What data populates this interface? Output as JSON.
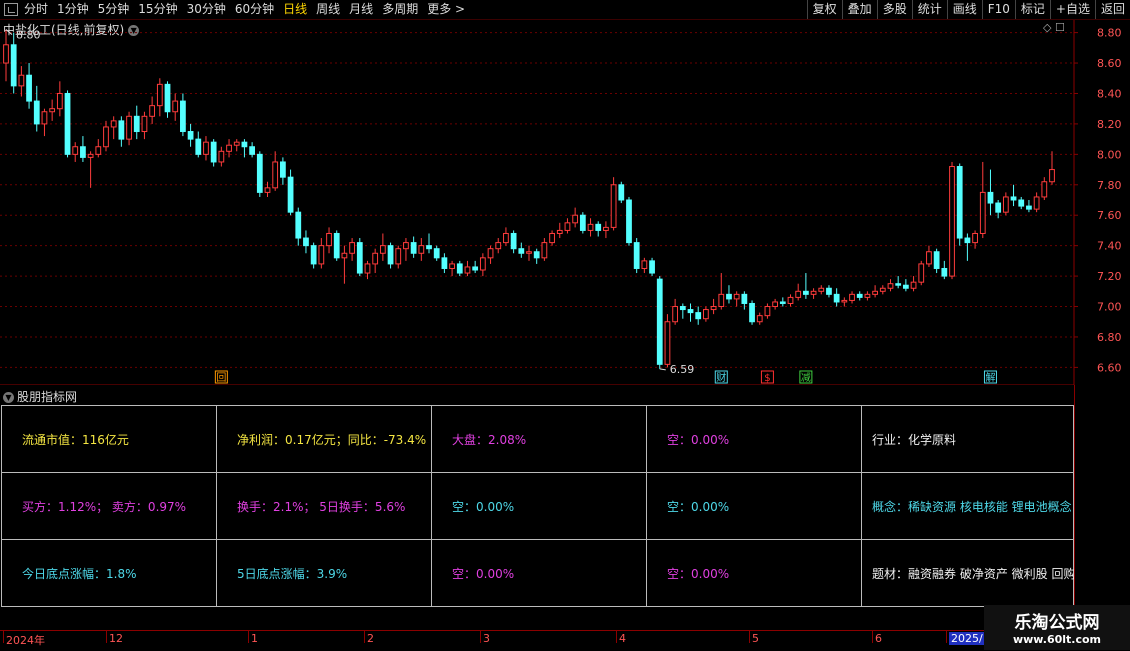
{
  "toolbar": {
    "periods": [
      "分时",
      "1分钟",
      "5分钟",
      "15分钟",
      "30分钟",
      "60分钟",
      "日线",
      "周线",
      "月线",
      "多周期",
      "更多 >"
    ],
    "active_period": "日线",
    "buttons": [
      "复权",
      "叠加",
      "多股",
      "统计",
      "画线",
      "F10",
      "标记",
      "+自选",
      "返回"
    ]
  },
  "chart": {
    "title": "中盐化工(日线,前复权)",
    "top_icons": "◇ ☐",
    "high_label": "8.80",
    "low_label": "6.59",
    "markers": [
      {
        "text": "回",
        "color": "#ff9900"
      },
      {
        "text": "财",
        "color": "#4ed8e8"
      },
      {
        "text": "$",
        "color": "#ff3030"
      },
      {
        "text": "减",
        "color": "#40d040"
      },
      {
        "text": "解",
        "color": "#4ed8e8"
      }
    ]
  },
  "chart_data": {
    "type": "candlestick",
    "y_ticks": [
      "8.80",
      "8.60",
      "8.40",
      "8.20",
      "8.00",
      "7.80",
      "7.60",
      "7.40",
      "7.20",
      "7.00",
      "6.80",
      "6.60"
    ],
    "ylim": [
      6.55,
      8.85
    ],
    "x_labels": [
      "2024年",
      "12",
      "1",
      "2",
      "3",
      "4",
      "5",
      "6",
      "2025/"
    ],
    "candles_note": "daily OHLC read approximately from screenshot",
    "candles": [
      [
        8.6,
        8.82,
        8.48,
        8.72
      ],
      [
        8.72,
        8.8,
        8.4,
        8.45
      ],
      [
        8.45,
        8.58,
        8.38,
        8.52
      ],
      [
        8.52,
        8.6,
        8.3,
        8.35
      ],
      [
        8.35,
        8.45,
        8.15,
        8.2
      ],
      [
        8.2,
        8.3,
        8.12,
        8.28
      ],
      [
        8.28,
        8.36,
        8.22,
        8.3
      ],
      [
        8.3,
        8.48,
        8.25,
        8.4
      ],
      [
        8.4,
        8.42,
        7.98,
        8.0
      ],
      [
        8.0,
        8.08,
        7.95,
        8.05
      ],
      [
        8.05,
        8.12,
        7.95,
        7.98
      ],
      [
        7.98,
        8.02,
        7.78,
        8.0
      ],
      [
        8.0,
        8.1,
        7.98,
        8.05
      ],
      [
        8.05,
        8.22,
        8.02,
        8.18
      ],
      [
        8.18,
        8.25,
        8.1,
        8.22
      ],
      [
        8.22,
        8.25,
        8.05,
        8.1
      ],
      [
        8.1,
        8.28,
        8.06,
        8.25
      ],
      [
        8.25,
        8.32,
        8.1,
        8.15
      ],
      [
        8.15,
        8.28,
        8.1,
        8.25
      ],
      [
        8.25,
        8.38,
        8.2,
        8.32
      ],
      [
        8.32,
        8.5,
        8.25,
        8.46
      ],
      [
        8.46,
        8.48,
        8.24,
        8.28
      ],
      [
        8.28,
        8.4,
        8.22,
        8.35
      ],
      [
        8.35,
        8.4,
        8.12,
        8.15
      ],
      [
        8.15,
        8.2,
        8.05,
        8.1
      ],
      [
        8.1,
        8.15,
        7.98,
        8.0
      ],
      [
        8.0,
        8.12,
        7.96,
        8.08
      ],
      [
        8.08,
        8.1,
        7.92,
        7.95
      ],
      [
        7.95,
        8.05,
        7.92,
        8.02
      ],
      [
        8.02,
        8.1,
        7.98,
        8.06
      ],
      [
        8.06,
        8.1,
        8.02,
        8.08
      ],
      [
        8.08,
        8.1,
        7.98,
        8.05
      ],
      [
        8.05,
        8.08,
        7.98,
        8.0
      ],
      [
        8.0,
        8.02,
        7.72,
        7.75
      ],
      [
        7.75,
        7.82,
        7.72,
        7.78
      ],
      [
        7.78,
        8.02,
        7.76,
        7.95
      ],
      [
        7.95,
        7.98,
        7.8,
        7.85
      ],
      [
        7.85,
        7.9,
        7.6,
        7.62
      ],
      [
        7.62,
        7.65,
        7.4,
        7.45
      ],
      [
        7.45,
        7.5,
        7.35,
        7.4
      ],
      [
        7.4,
        7.42,
        7.25,
        7.28
      ],
      [
        7.28,
        7.45,
        7.25,
        7.4
      ],
      [
        7.4,
        7.52,
        7.35,
        7.48
      ],
      [
        7.48,
        7.5,
        7.3,
        7.32
      ],
      [
        7.32,
        7.4,
        7.15,
        7.35
      ],
      [
        7.35,
        7.45,
        7.3,
        7.42
      ],
      [
        7.42,
        7.45,
        7.2,
        7.22
      ],
      [
        7.22,
        7.3,
        7.18,
        7.28
      ],
      [
        7.28,
        7.38,
        7.22,
        7.35
      ],
      [
        7.35,
        7.48,
        7.3,
        7.4
      ],
      [
        7.4,
        7.42,
        7.25,
        7.28
      ],
      [
        7.28,
        7.4,
        7.25,
        7.38
      ],
      [
        7.38,
        7.45,
        7.3,
        7.42
      ],
      [
        7.42,
        7.46,
        7.32,
        7.35
      ],
      [
        7.35,
        7.45,
        7.3,
        7.4
      ],
      [
        7.4,
        7.48,
        7.35,
        7.38
      ],
      [
        7.38,
        7.4,
        7.3,
        7.32
      ],
      [
        7.32,
        7.35,
        7.22,
        7.25
      ],
      [
        7.25,
        7.3,
        7.2,
        7.28
      ],
      [
        7.28,
        7.3,
        7.2,
        7.22
      ],
      [
        7.22,
        7.3,
        7.2,
        7.26
      ],
      [
        7.26,
        7.3,
        7.22,
        7.24
      ],
      [
        7.24,
        7.35,
        7.2,
        7.32
      ],
      [
        7.32,
        7.4,
        7.28,
        7.38
      ],
      [
        7.38,
        7.45,
        7.35,
        7.42
      ],
      [
        7.42,
        7.52,
        7.4,
        7.48
      ],
      [
        7.48,
        7.5,
        7.35,
        7.38
      ],
      [
        7.38,
        7.42,
        7.32,
        7.35
      ],
      [
        7.35,
        7.4,
        7.3,
        7.36
      ],
      [
        7.36,
        7.38,
        7.28,
        7.32
      ],
      [
        7.32,
        7.45,
        7.3,
        7.42
      ],
      [
        7.42,
        7.5,
        7.4,
        7.48
      ],
      [
        7.48,
        7.55,
        7.45,
        7.5
      ],
      [
        7.5,
        7.58,
        7.48,
        7.55
      ],
      [
        7.55,
        7.65,
        7.52,
        7.6
      ],
      [
        7.6,
        7.62,
        7.48,
        7.5
      ],
      [
        7.5,
        7.58,
        7.46,
        7.54
      ],
      [
        7.54,
        7.56,
        7.46,
        7.5
      ],
      [
        7.5,
        7.56,
        7.45,
        7.52
      ],
      [
        7.52,
        7.85,
        7.5,
        7.8
      ],
      [
        7.8,
        7.82,
        7.68,
        7.7
      ],
      [
        7.7,
        7.72,
        7.4,
        7.42
      ],
      [
        7.42,
        7.45,
        7.22,
        7.25
      ],
      [
        7.25,
        7.32,
        7.22,
        7.3
      ],
      [
        7.3,
        7.32,
        7.2,
        7.22
      ],
      [
        7.18,
        7.2,
        6.59,
        6.62
      ],
      [
        6.62,
        6.95,
        6.6,
        6.9
      ],
      [
        6.9,
        7.05,
        6.88,
        7.0
      ],
      [
        7.0,
        7.02,
        6.92,
        6.98
      ],
      [
        6.98,
        7.02,
        6.9,
        6.96
      ],
      [
        6.96,
        7.0,
        6.88,
        6.92
      ],
      [
        6.92,
        7.0,
        6.9,
        6.98
      ],
      [
        6.98,
        7.05,
        6.95,
        7.0
      ],
      [
        7.0,
        7.22,
        6.98,
        7.08
      ],
      [
        7.08,
        7.14,
        7.02,
        7.05
      ],
      [
        7.05,
        7.1,
        7.0,
        7.08
      ],
      [
        7.08,
        7.1,
        6.98,
        7.02
      ],
      [
        7.02,
        7.04,
        6.88,
        6.9
      ],
      [
        6.9,
        6.96,
        6.88,
        6.94
      ],
      [
        6.94,
        7.02,
        6.92,
        7.0
      ],
      [
        7.0,
        7.05,
        6.98,
        7.03
      ],
      [
        7.03,
        7.06,
        7.0,
        7.02
      ],
      [
        7.02,
        7.08,
        7.0,
        7.06
      ],
      [
        7.06,
        7.15,
        7.04,
        7.1
      ],
      [
        7.1,
        7.22,
        7.05,
        7.08
      ],
      [
        7.08,
        7.12,
        7.05,
        7.1
      ],
      [
        7.1,
        7.14,
        7.08,
        7.12
      ],
      [
        7.12,
        7.14,
        7.06,
        7.08
      ],
      [
        7.08,
        7.12,
        7.0,
        7.03
      ],
      [
        7.03,
        7.06,
        7.0,
        7.04
      ],
      [
        7.04,
        7.1,
        7.02,
        7.08
      ],
      [
        7.08,
        7.1,
        7.04,
        7.06
      ],
      [
        7.06,
        7.1,
        7.04,
        7.08
      ],
      [
        7.08,
        7.14,
        7.06,
        7.1
      ],
      [
        7.1,
        7.14,
        7.08,
        7.12
      ],
      [
        7.12,
        7.18,
        7.1,
        7.15
      ],
      [
        7.15,
        7.2,
        7.12,
        7.14
      ],
      [
        7.14,
        7.18,
        7.1,
        7.12
      ],
      [
        7.12,
        7.2,
        7.1,
        7.16
      ],
      [
        7.16,
        7.3,
        7.14,
        7.28
      ],
      [
        7.28,
        7.4,
        7.26,
        7.36
      ],
      [
        7.36,
        7.38,
        7.22,
        7.25
      ],
      [
        7.25,
        7.3,
        7.18,
        7.2
      ],
      [
        7.2,
        7.95,
        7.18,
        7.92
      ],
      [
        7.92,
        7.94,
        7.4,
        7.45
      ],
      [
        7.45,
        7.48,
        7.3,
        7.42
      ],
      [
        7.42,
        7.5,
        7.38,
        7.48
      ],
      [
        7.48,
        7.95,
        7.45,
        7.75
      ],
      [
        7.75,
        7.9,
        7.6,
        7.68
      ],
      [
        7.68,
        7.7,
        7.58,
        7.62
      ],
      [
        7.62,
        7.75,
        7.6,
        7.72
      ],
      [
        7.72,
        7.8,
        7.66,
        7.7
      ],
      [
        7.7,
        7.72,
        7.64,
        7.66
      ],
      [
        7.66,
        7.7,
        7.62,
        7.64
      ],
      [
        7.64,
        7.75,
        7.62,
        7.72
      ],
      [
        7.72,
        7.85,
        7.7,
        7.82
      ],
      [
        7.82,
        8.02,
        7.8,
        7.9
      ]
    ]
  },
  "panel": {
    "title": "股朋指标网",
    "cells": [
      [
        "流通市值：116亿元",
        "净利润：0.17亿元；同比：-73.4%",
        "大盘：2.08%",
        "空：0.00%",
        "行业：化学原料"
      ],
      [
        "买方：1.12%；  卖方：0.97%",
        "换手：2.1%；  5日换手：5.6%",
        "空：0.00%",
        "空：0.00%",
        "概念：稀缺资源 核电核能 锂电池概念"
      ],
      [
        "今日底点涨幅：1.8%",
        "5日底点涨幅：3.9%",
        "空：0.00%",
        "空：0.00%",
        "题材：融资融券 破净资产 微利股 回购"
      ]
    ],
    "cell_colors": [
      [
        "#f5e642",
        "#f5e642",
        "#e040e0",
        "#e040e0",
        "#f0f0f0"
      ],
      [
        "#e040e0",
        "#e040e0",
        "#4ed8e8",
        "#4ed8e8",
        "#4ed8e8"
      ],
      [
        "#4ed8e8",
        "#4ed8e8",
        "#e040e0",
        "#e040e0",
        "#f0f0f0"
      ]
    ]
  },
  "watermark": {
    "line1": "乐淘公式网",
    "line2": "www.60lt.com"
  }
}
